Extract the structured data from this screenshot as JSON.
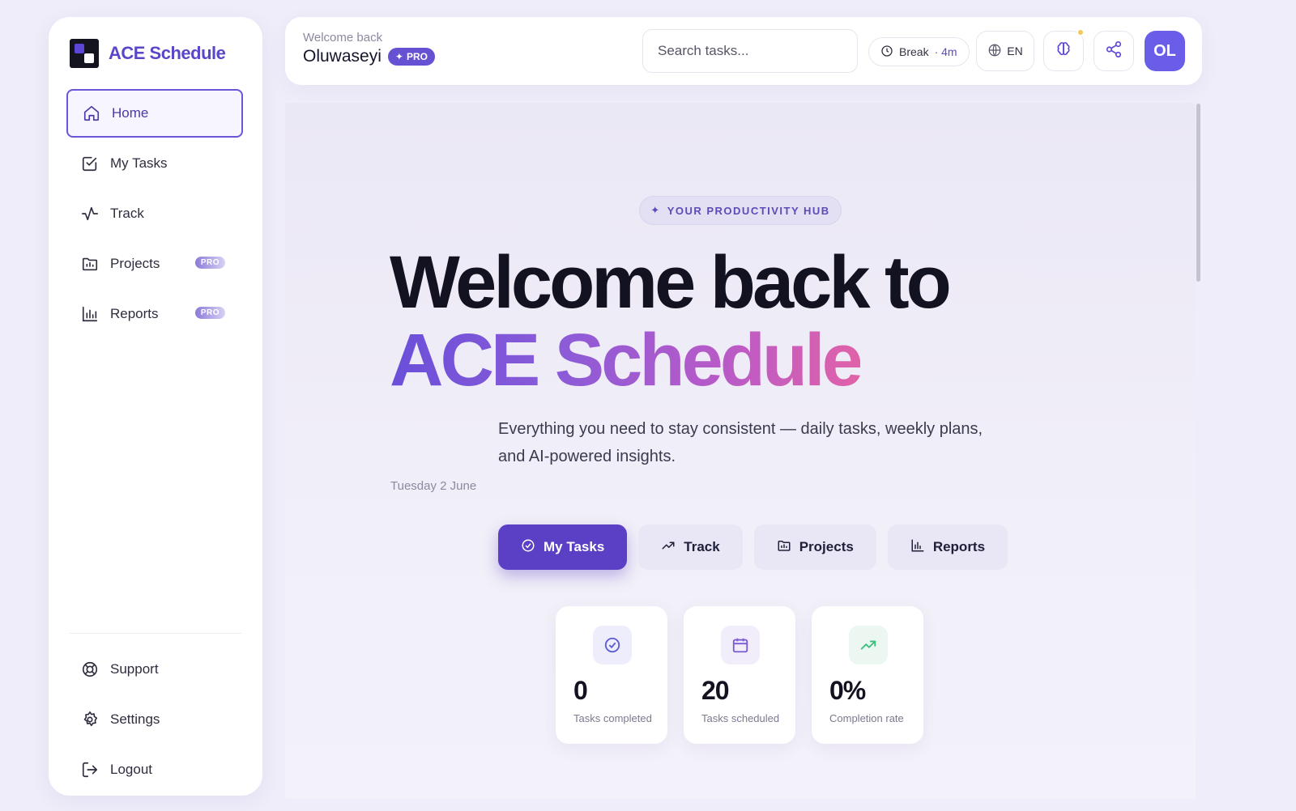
{
  "brand": {
    "name": "ACE Schedule"
  },
  "sidebar": {
    "items": [
      {
        "label": "Home",
        "icon": "home-icon",
        "active": true
      },
      {
        "label": "My Tasks",
        "icon": "checkbox-icon"
      },
      {
        "label": "Track",
        "icon": "activity-icon"
      },
      {
        "label": "Projects",
        "icon": "folder-icon",
        "badge": "PRO"
      },
      {
        "label": "Reports",
        "icon": "bar-chart-icon",
        "badge": "PRO"
      }
    ],
    "bottom": [
      {
        "label": "Support",
        "icon": "lifebuoy-icon"
      },
      {
        "label": "Settings",
        "icon": "gear-icon"
      },
      {
        "label": "Logout",
        "icon": "logout-icon"
      }
    ]
  },
  "header": {
    "greeting": "Welcome back",
    "user_name": "Oluwaseyi",
    "pro_badge": "PRO",
    "search_placeholder": "Search tasks...",
    "break_label": "Break",
    "break_time": "· 4m",
    "language": "EN",
    "avatar_initials": "OL"
  },
  "hero": {
    "pill": "YOUR PRODUCTIVITY HUB",
    "title_line1": "Welcome back to",
    "title_line2": "ACE Schedule",
    "subtitle": "Everything you need to stay consistent — daily tasks, weekly plans, and AI-powered insights.",
    "date": "Tuesday 2 June"
  },
  "actions": [
    {
      "label": "My Tasks",
      "icon": "check-circle-icon",
      "primary": true
    },
    {
      "label": "Track",
      "icon": "trending-up-icon"
    },
    {
      "label": "Projects",
      "icon": "folder-icon"
    },
    {
      "label": "Reports",
      "icon": "bar-chart-icon"
    }
  ],
  "stats": [
    {
      "value": "0",
      "label": "Tasks completed",
      "icon": "check-circle-icon",
      "color": "#5b5bd6"
    },
    {
      "value": "20",
      "label": "Tasks scheduled",
      "icon": "calendar-icon",
      "color": "#7b5bd6"
    },
    {
      "value": "0%",
      "label": "Completion rate",
      "icon": "trending-up-icon",
      "color": "#3cbf7a"
    }
  ],
  "colors": {
    "accent": "#5b3fc4",
    "brand": "#5847c9",
    "avatar": "#6a5de8"
  }
}
